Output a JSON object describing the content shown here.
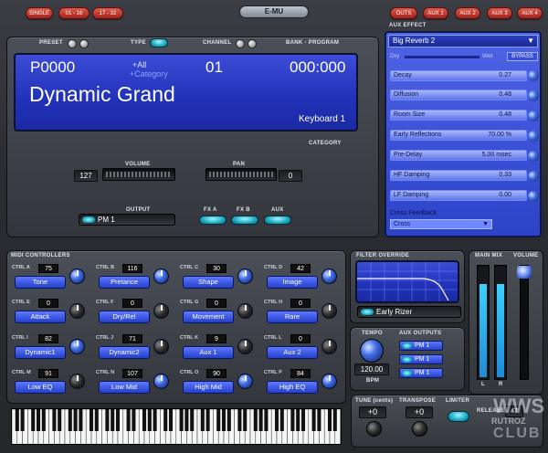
{
  "top_buttons": {
    "single": "SINGLE",
    "range1": "01 - 16",
    "range2": "17 - 32",
    "outs": "OUTS",
    "aux1": "AUX 1",
    "aux2": "AUX 2",
    "aux3": "AUX 3",
    "aux4": "AUX 4"
  },
  "brand": "E-MU",
  "preset_panel": {
    "preset_label": "PRESET",
    "type_label": "TYPE",
    "channel_label": "CHANNEL",
    "bank_label": "BANK - PROGRAM",
    "preset_number": "P0000",
    "type_all": "+All",
    "type_category": "+Category",
    "channel": "01",
    "bank_program": "000:000",
    "preset_name": "Dynamic Grand",
    "category_value": "Keyboard 1",
    "category_label": "CATEGORY"
  },
  "mixer": {
    "volume_label": "VOLUME",
    "volume_value": "127",
    "pan_label": "PAN",
    "pan_value": "0",
    "output_label": "OUTPUT",
    "output_value": "PM 1",
    "fxa_label": "FX A",
    "fxb_label": "FX B",
    "aux_label": "AUX"
  },
  "aux_effect": {
    "title": "AUX EFFECT",
    "effect_name": "Big Reverb 2",
    "dry_label": "Dry",
    "wet_label": "Wet",
    "bypass_label": "BYPASS",
    "params": [
      {
        "name": "Decay",
        "value": "0.27"
      },
      {
        "name": "Diffusion",
        "value": "0.48"
      },
      {
        "name": "Room Size",
        "value": "0.48"
      },
      {
        "name": "Early Reflections",
        "value": "70.00 %"
      },
      {
        "name": "Pre-Delay",
        "value": "5.00 msec"
      },
      {
        "name": "HF Damping",
        "value": "0.33"
      },
      {
        "name": "LF Damping",
        "value": "0.00"
      },
      {
        "name": "Cross Feedback",
        "value": "Cross"
      }
    ]
  },
  "midi": {
    "title": "MIDI CONTROLLERS",
    "controllers": [
      {
        "id": "CTRL A",
        "value": "75",
        "label": "Tone"
      },
      {
        "id": "CTRL B",
        "value": "116",
        "label": "Pretance"
      },
      {
        "id": "CTRL C",
        "value": "30",
        "label": "Shape"
      },
      {
        "id": "CTRL D",
        "value": "42",
        "label": "Image"
      },
      {
        "id": "CTRL E",
        "value": "0",
        "label": "Attack"
      },
      {
        "id": "CTRL F",
        "value": "0",
        "label": "Dry/Rel"
      },
      {
        "id": "CTRL G",
        "value": "0",
        "label": "Movement"
      },
      {
        "id": "CTRL H",
        "value": "0",
        "label": "Rare"
      },
      {
        "id": "CTRL I",
        "value": "82",
        "label": "Dynamic1"
      },
      {
        "id": "CTRL J",
        "value": "71",
        "label": "Dynamic2"
      },
      {
        "id": "CTRL K",
        "value": "9",
        "label": "Aux 1"
      },
      {
        "id": "CTRL L",
        "value": "0",
        "label": "Aux 2"
      },
      {
        "id": "CTRL M",
        "value": "91",
        "label": "Low EQ"
      },
      {
        "id": "CTRL N",
        "value": "107",
        "label": "Low Mid"
      },
      {
        "id": "CTRL O",
        "value": "90",
        "label": "High Mid"
      },
      {
        "id": "CTRL P",
        "value": "84",
        "label": "High EQ"
      }
    ]
  },
  "filter": {
    "title": "FILTER OVERRIDE",
    "value": "Early Rizer"
  },
  "tempo": {
    "title": "TEMPO",
    "value": "120.00",
    "unit": "BPM",
    "aux_outputs_label": "AUX OUTPUTS",
    "outputs": [
      "PM 1",
      "PM 1",
      "PM 1"
    ]
  },
  "meters": {
    "main_label": "MAIN MIX",
    "volume_label": "VOLUME",
    "left": "L",
    "right": "R"
  },
  "bottom": {
    "tune_label": "TUNE (cents)",
    "tune_value": "+0",
    "transpose_label": "TRANSPOSE",
    "transpose_value": "+0",
    "limiter_label": "LIMITER",
    "release_label": "RELEASE",
    "release_value": "47"
  },
  "watermark": {
    "line1": "WWS",
    "line2": "RUTROZ",
    "line3": "CLUB"
  }
}
